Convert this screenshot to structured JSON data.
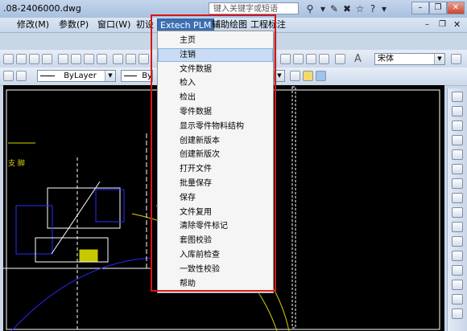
{
  "window": {
    "title": ".08-2406000.dwg",
    "search_placeholder": "键入关键字或短语",
    "controls": [
      "–",
      "❐",
      "✕"
    ]
  },
  "menubar": {
    "items": [
      "修改(M)",
      "参数(P)",
      "窗口(W)",
      "初设",
      "Extech PLM",
      "辅助绘图",
      "工程标注"
    ]
  },
  "toolbar": {
    "layer_value": "ByLayer",
    "layer_value_2": "By",
    "font_value": "宋体"
  },
  "dropdown": {
    "items": [
      "主页",
      "注销",
      "文件数据",
      "检入",
      "检出",
      "零件数据",
      "显示零件物料结构",
      "创建新版本",
      "创建新版次",
      "打开文件",
      "批量保存",
      "保存",
      "文件复用",
      "清除零件标记",
      "套图校验",
      "入库前检查",
      "一致性校验",
      "帮助"
    ],
    "highlighted_index": 1
  },
  "drawing": {
    "label_left": "支  脚"
  },
  "colors": {
    "highlight_frame": "#d81515",
    "menu_active": "#3d6fb4",
    "canvas": "#000000"
  }
}
